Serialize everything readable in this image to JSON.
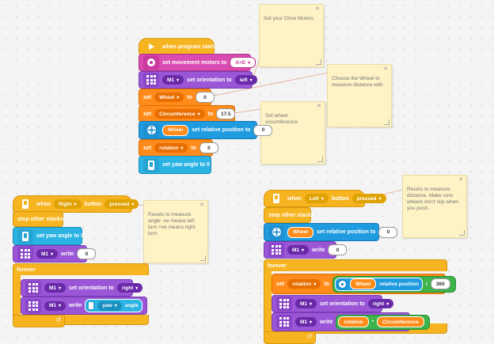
{
  "notes": [
    {
      "text": "Set your Drive Motors"
    },
    {
      "text": "Choose the Wheel to measure distance with"
    },
    {
      "text": "Set wheel circumference"
    },
    {
      "text": "Resets to measure angle -ve means left turn +ve means right turn"
    },
    {
      "text": "Resets to measure distance. Make sure wheels don't slip when you push."
    }
  ],
  "stack1": {
    "hat": "when program starts",
    "movement": {
      "label": "set movement motors to",
      "value": "A+E"
    },
    "orient": {
      "motor": "M1",
      "label": "set orientation to",
      "value": "left"
    },
    "setwheel": {
      "set": "set",
      "var": "Wheel",
      "to": "to",
      "value": "0"
    },
    "setcirc": {
      "set": "set",
      "var": "Circumference",
      "to": "to",
      "value": "17.5"
    },
    "relpos": {
      "var": "Wheel",
      "label": "set relative position to",
      "value": "0"
    },
    "setrot": {
      "set": "set",
      "var": "rotation",
      "to": "to",
      "value": "0"
    },
    "yaw": {
      "label": "set yaw angle to 0"
    }
  },
  "stack2": {
    "hat": {
      "when": "when",
      "button": "Right",
      "label": "button",
      "state": "pressed"
    },
    "stop": "stop other stacks",
    "yaw": "set yaw angle to 0",
    "write": {
      "motor": "M1",
      "label": "write",
      "value": "0"
    },
    "forever": "forever",
    "orient": {
      "motor": "M1",
      "label": "set orientation to",
      "value": "right"
    },
    "write2": {
      "motor": "M1",
      "label": "write",
      "var": "yaw",
      "sensor": "angle"
    }
  },
  "stack3": {
    "hat": {
      "when": "when",
      "button": "Left",
      "label": "button",
      "state": "pressed"
    },
    "stop": "stop other stacks",
    "relpos": {
      "var": "Wheel",
      "label": "set relative position to",
      "value": "0"
    },
    "write": {
      "motor": "M1",
      "label": "write",
      "value": "0"
    },
    "forever": "forever",
    "setrot": {
      "set": "set",
      "var": "rotation",
      "to": "to",
      "wheel": "Wheel",
      "rel": "relative position",
      "div": "/",
      "value": "360"
    },
    "orient": {
      "motor": "M1",
      "label": "set orientation to",
      "value": "right"
    },
    "write2": {
      "motor": "M1",
      "label": "write",
      "a": "rotation",
      "op": "*",
      "b": "Circumference"
    }
  },
  "colors": {
    "events": "#f6b420",
    "motors": "#9a56d6",
    "variables": "#ff8c1a",
    "sensors": "#1f9be0",
    "note": "#fdf3c5"
  }
}
